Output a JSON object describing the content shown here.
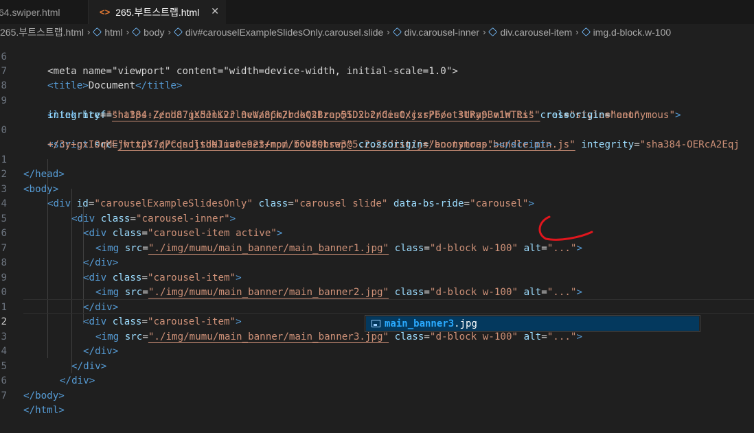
{
  "tabs": [
    {
      "label": "64.swiper.html",
      "active": false
    },
    {
      "label": "265.부트스트랩.html",
      "active": true,
      "icon": "html-icon"
    }
  ],
  "breadcrumb": [
    "265.부트스트랩.html",
    "html",
    "body",
    "div#carouselExampleSlidesOnly.carousel.slide",
    "div.carousel-inner",
    "div.carousel-item",
    "img.d-block.w-100"
  ],
  "line_numbers": [
    "6",
    "7",
    "8",
    "9",
    "",
    "0",
    "",
    "1",
    "2",
    "3",
    "4",
    "5",
    "6",
    "7",
    "8",
    "9",
    "0",
    "1",
    "2",
    "3",
    "4",
    "5",
    "6",
    "7"
  ],
  "code": {
    "l_meta_a": "<meta name=\"viewport\" content=\"width=device-width, initial-scale=1.0\">",
    "title_open": "<title>",
    "title_text": "Document",
    "title_close": "</title>",
    "link_href": "\"https://cdn.jsdelivr.net/npm/bootstrap@5.2.2/dist/css/bootstrap.min.css\"",
    "link_rel": "\"stylesheet\"",
    "link_integrity": "\"sha384-Zenh87qX5JnK2Jl0vWa8Ck2rdkQ2Bzep5IDxbcnCeuOxjzrPF/et3URy9Bv1WTRi\"",
    "anon": "\"anonymous\"",
    "script_src": "\"https://cdn.jsdelivr.net/npm/bootstrap@5.2.2/dist/js/bootstrap.bundle.min.js\"",
    "script_integrity_a": "\"sha384-OERcA2Eqj",
    "script_integrity_b": "+/3y+gxIOqMEjwtxJY7qPCqsdltbNJuaOe923+mo//f6V8Qbsw3\"",
    "div_id": "\"carouselExampleSlidesOnly\"",
    "div_class": "\"carousel slide\"",
    "div_ride": "\"carousel\"",
    "inner_class": "\"carousel-inner\"",
    "item_active_class": "\"carousel-item active\"",
    "item_class": "\"carousel-item\"",
    "img1": "\"./img/mumu/main_banner/main_banner1.jpg\"",
    "img2": "\"./img/mumu/main_banner/main_banner2.jpg\"",
    "img3": "\"./img/mumu/main_banner/main_banner3.jpg\"",
    "img_class": "\"d-block w-100\"",
    "alt": "\"...\""
  },
  "suggestion": {
    "match": "main_banner3",
    "rest": ".jpg"
  },
  "colors": {
    "tag": "#569cd6",
    "attr": "#9cdcfe",
    "string": "#ce9178",
    "annotation": "#e0161d",
    "suggest_bg": "#04395e"
  }
}
